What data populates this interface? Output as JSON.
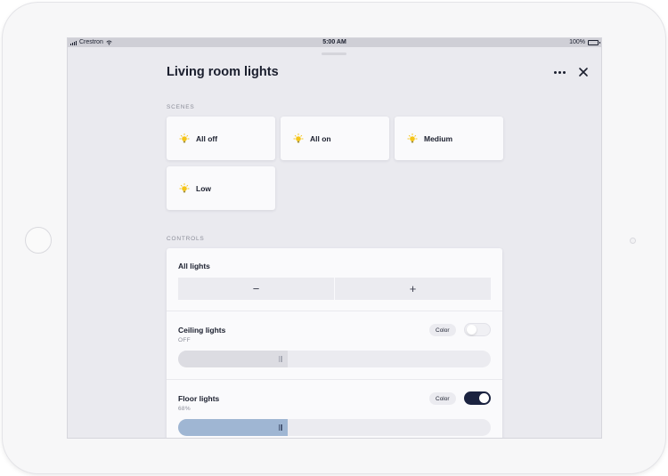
{
  "statusbar": {
    "carrier": "Crestron",
    "time": "5:00 AM",
    "battery": "100%"
  },
  "panel": {
    "title": "Living room lights",
    "more_icon": "more-horizontal-icon",
    "close_icon": "close-icon"
  },
  "scenes": {
    "label": "SCENES",
    "items": [
      {
        "label": "All off",
        "icon": "lightbulb-icon"
      },
      {
        "label": "All on",
        "icon": "lightbulb-icon"
      },
      {
        "label": "Medium",
        "icon": "lightbulb-icon"
      },
      {
        "label": "Low",
        "icon": "lightbulb-icon"
      }
    ]
  },
  "controls": {
    "label": "CONTROLS",
    "all_lights": {
      "title": "All lights",
      "decrease_label": "−",
      "increase_label": "+"
    },
    "ceiling": {
      "title": "Ceiling lights",
      "status": "OFF",
      "color_label": "Color",
      "on": false,
      "level": 0.35
    },
    "floor": {
      "title": "Floor lights",
      "status": "68%",
      "color_label": "Color",
      "on": true,
      "level": 0.35
    }
  },
  "colors": {
    "accent_bulb": "#f5c518",
    "toggle_on": "#1b2340",
    "slider_active": "#9fb6d3",
    "slider_inactive_fill": "#dcdce2"
  }
}
